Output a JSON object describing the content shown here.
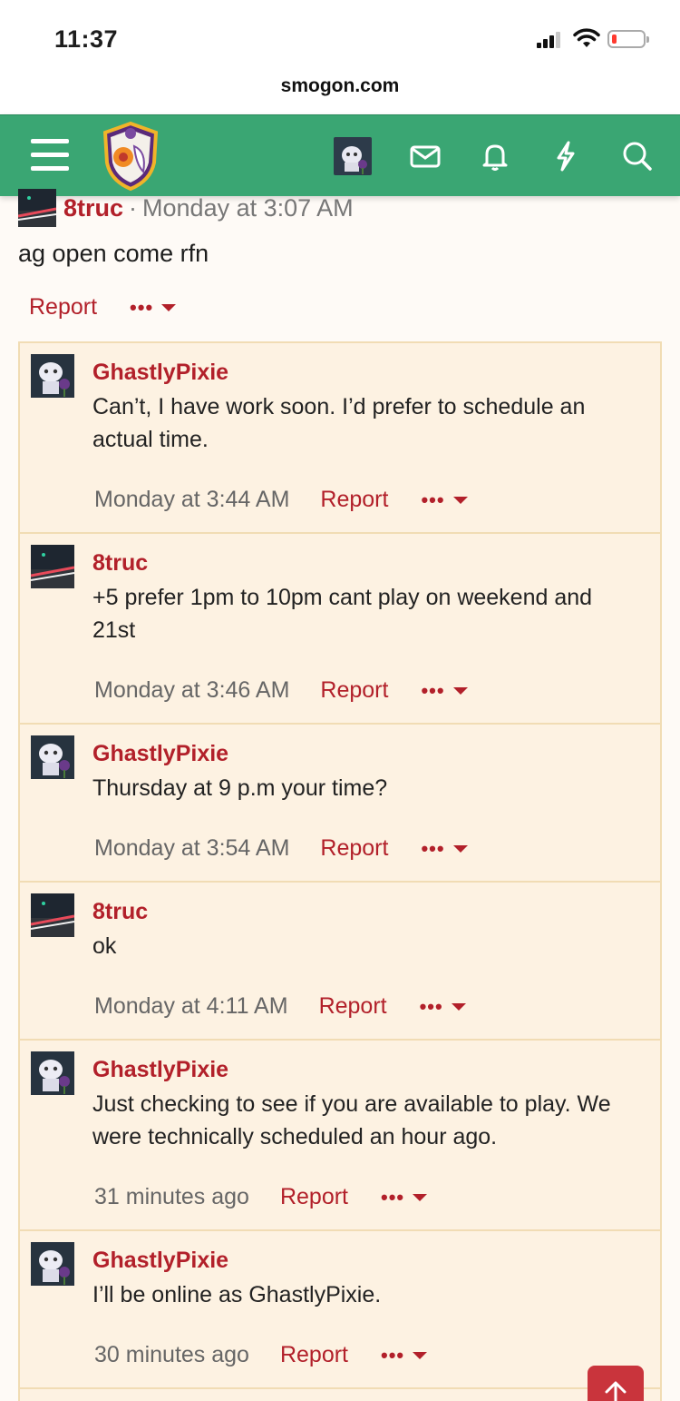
{
  "status_bar": {
    "time": "11:37",
    "battery_color": "#ff3b30"
  },
  "browser": {
    "url": "smogon.com"
  },
  "header": {
    "bg_color": "#3aa673",
    "icons": [
      "menu-icon",
      "site-logo",
      "user-avatar",
      "mail-icon",
      "bell-icon",
      "bolt-icon",
      "search-icon"
    ]
  },
  "post": {
    "author": "8truc",
    "separator": "·",
    "date": "Monday at 3:07 AM",
    "body": "ag open come rfn",
    "report_label": "Report",
    "more_label": "•••"
  },
  "comments": [
    {
      "author": "GhastlyPixie",
      "avatar": "pixie",
      "text": "Can’t, I have work soon. I’d prefer to schedule an actual time.",
      "time": "Monday at 3:44 AM",
      "report_label": "Report",
      "more_label": "•••"
    },
    {
      "author": "8truc",
      "avatar": "truc",
      "text": "+5 prefer 1pm to 10pm cant play on weekend and 21st",
      "time": "Monday at 3:46 AM",
      "report_label": "Report",
      "more_label": "•••"
    },
    {
      "author": "GhastlyPixie",
      "avatar": "pixie",
      "text": "Thursday at 9 p.m your time?",
      "time": "Monday at 3:54 AM",
      "report_label": "Report",
      "more_label": "•••"
    },
    {
      "author": "8truc",
      "avatar": "truc",
      "text": "ok",
      "time": "Monday at 4:11 AM",
      "report_label": "Report",
      "more_label": "•••"
    },
    {
      "author": "GhastlyPixie",
      "avatar": "pixie",
      "text": "Just checking to see if you are available to play. We were technically scheduled an hour ago.",
      "time": "31 minutes ago",
      "report_label": "Report",
      "more_label": "•••"
    },
    {
      "author": "GhastlyPixie",
      "avatar": "pixie",
      "text": "I’ll be online as GhastlyPixie.",
      "time": "30 minutes ago",
      "report_label": "Report",
      "more_label": "•••"
    }
  ],
  "colors": {
    "accent": "#b2202a",
    "comment_bg": "#fdf2e2",
    "comment_border": "#f1dcb4",
    "to_top_button": "#c9343c"
  }
}
